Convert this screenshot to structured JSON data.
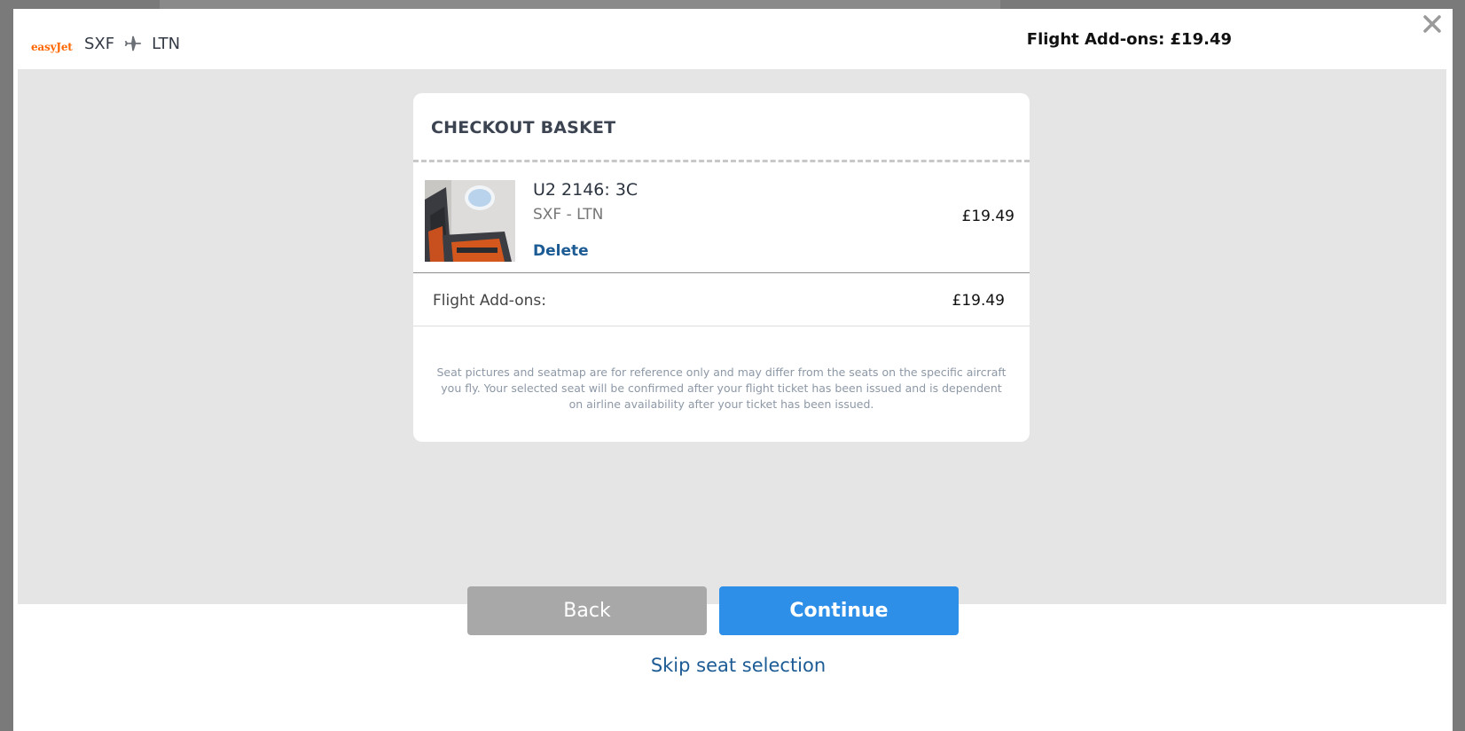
{
  "header": {
    "brand": "easyJet",
    "origin": "SXF",
    "destination": "LTN",
    "addons_total": "Flight Add-ons: £19.49"
  },
  "basket": {
    "title": "CHECKOUT BASKET",
    "item": {
      "seat_code": "U2 2146: 3C",
      "route": "SXF - LTN",
      "delete_label": "Delete",
      "price": "£19.49"
    },
    "subtotal": {
      "label": "Flight Add-ons:",
      "value": "£19.49"
    },
    "disclaimer": "Seat pictures and seatmap are for reference only and may differ from the seats on the specific aircraft you fly. Your selected seat will be confirmed after your flight ticket has been issued and is dependent on airline availability after your ticket has been issued."
  },
  "footer": {
    "back_label": "Back",
    "continue_label": "Continue",
    "skip_label": "Skip seat selection"
  },
  "colors": {
    "brand": "#ff6600",
    "primary": "#2e8fe8",
    "link": "#1c5b94"
  }
}
